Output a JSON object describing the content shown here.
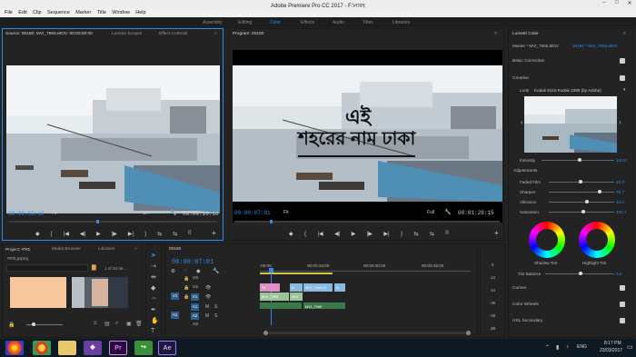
{
  "window": {
    "title": "Adobe Premiere Pro CC 2017 - F:\\নামহ"
  },
  "menu": [
    "File",
    "Edit",
    "Clip",
    "Sequence",
    "Marker",
    "Title",
    "Window",
    "Help"
  ],
  "workspaces": [
    "Assembly",
    "Editing",
    "Color",
    "Effects",
    "Audio",
    "Titles",
    "Libraries"
  ],
  "source": {
    "tabs": [
      "Source: 00180: MVI_7965.MOV: 00:00:00:00",
      "Lumetri Scopes",
      "Effect Controls"
    ],
    "timecode": "18:09:50:10",
    "fit": "Fit",
    "fraction": "1/4",
    "duration": "00:00:16:10"
  },
  "program": {
    "tab": "Program: 00180",
    "timecode": "00:00:07:01",
    "fit": "Fit",
    "quality": "Full",
    "duration": "00:01:28:15",
    "title_line1": "এই",
    "title_line2": "শহরের নাম ঢাকা"
  },
  "controls": [
    "◆",
    "{",
    "|◀",
    "◀|",
    "▶",
    "|▶",
    "▶|",
    "}",
    "⇆",
    "⇆",
    "⌷"
  ],
  "project": {
    "tabs": [
      "Project: নামহ",
      "Media Browser",
      "Libraries"
    ],
    "file": "নামহ.prproj",
    "count": "1 of 34 Ite..."
  },
  "timeline": {
    "tab": "00180",
    "timecode": "00:00:07:01",
    "ruler": [
      ":00:00",
      "00:00:15:00",
      "00:00:30:00",
      "00:00:45:00"
    ],
    "tracks": [
      "V3",
      "V2",
      "V1",
      "A1",
      "A2",
      "A3"
    ],
    "source_patch": [
      "V1",
      "A1"
    ],
    "clips": [
      "Tit",
      "A",
      "MVI_7965",
      "MVI",
      "MVI_7965.M",
      "A",
      "MVI_7965"
    ],
    "meter_scale": [
      "0",
      "-12",
      "-24",
      "-36",
      "-48",
      "dB"
    ]
  },
  "lumetri": {
    "tab": "Lumetri Color",
    "master": "Master * MVI_7965.MOV",
    "sequence": "00180 * MVI_7965.MOV",
    "basic": "Basic Correction",
    "creative": "Creative",
    "look_label": "Look",
    "look": "Kodak 5218 Kodak 2395 (by Adobe)",
    "intensity_label": "Intensity",
    "intensity": "100.0",
    "adjustments": "Adjustments",
    "sliders": [
      {
        "label": "Faded Film",
        "value": "46.0",
        "pos": 0.46
      },
      {
        "label": "Sharpen",
        "value": "75.7",
        "pos": 0.75
      },
      {
        "label": "Vibrance",
        "value": "12.0",
        "pos": 0.56
      },
      {
        "label": "Saturation",
        "value": "100.7",
        "pos": 0.5
      }
    ],
    "shadow_tint": "Shadow Tint",
    "highlight_tint": "Highlight Tint",
    "tint_balance_label": "Tint Balance",
    "tint_balance": "0.0",
    "curves": "Curves",
    "color_wheels": "Color Wheels",
    "hsl": "HSL Secondary"
  },
  "taskbar": {
    "lang": "ENG",
    "time": "8:17 PM",
    "date": "23/03/2017",
    "apps": [
      "Pr",
      "Ae"
    ]
  }
}
